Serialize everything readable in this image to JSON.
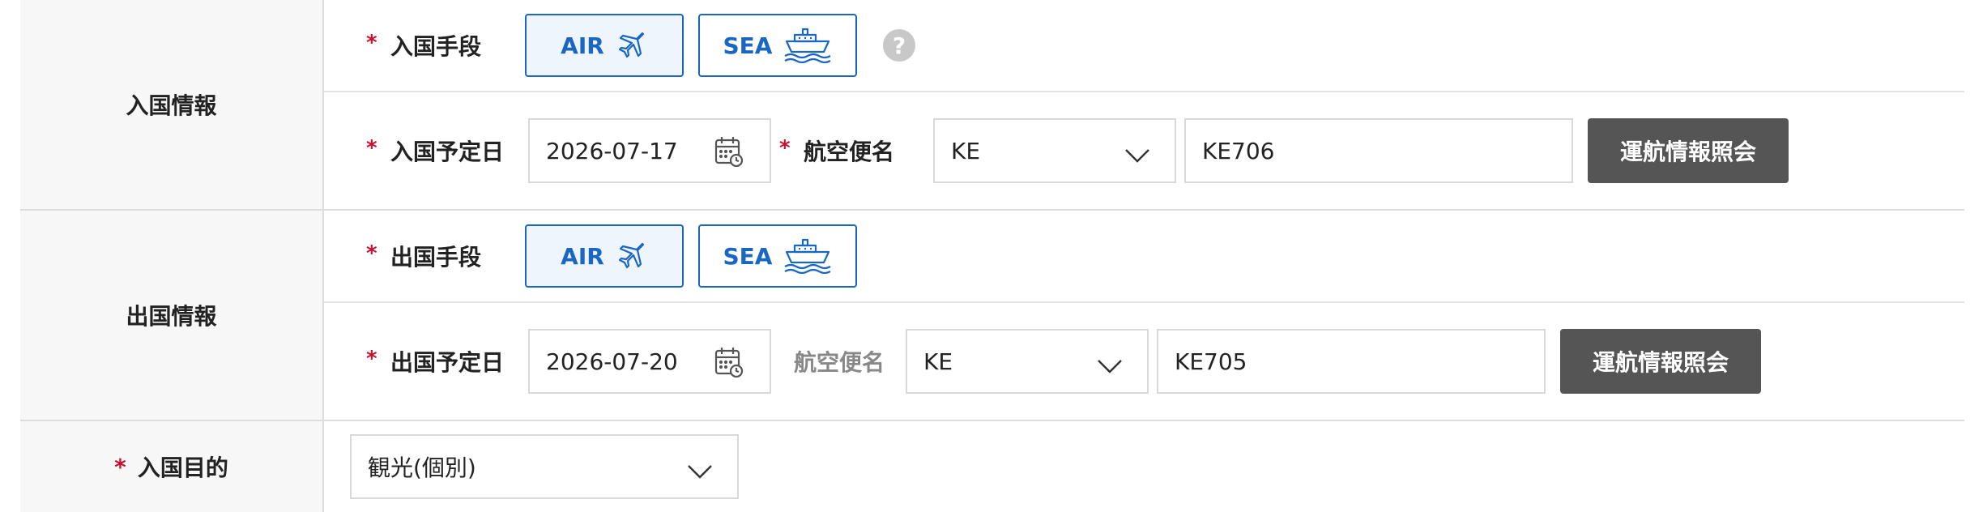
{
  "entry_info": {
    "section_label": "入国情報",
    "means_label": "入国手段",
    "means_options": [
      {
        "label": "AIR",
        "icon": "airplane-icon",
        "selected": true
      },
      {
        "label": "SEA",
        "icon": "ship-icon",
        "selected": false
      }
    ],
    "help": "?",
    "date_label": "入国予定日",
    "date_value": "2026-07-17",
    "flight_label": "航空便名",
    "airline_value": "KE",
    "flight_number": "KE706",
    "query_button": "運航情報照会"
  },
  "exit_info": {
    "section_label": "出国情報",
    "means_label": "出国手段",
    "means_options": [
      {
        "label": "AIR",
        "icon": "airplane-icon",
        "selected": true
      },
      {
        "label": "SEA",
        "icon": "ship-icon",
        "selected": false
      }
    ],
    "date_label": "出国予定日",
    "date_value": "2026-07-20",
    "flight_label": "航空便名",
    "airline_value": "KE",
    "flight_number": "KE705",
    "query_button": "運航情報照会"
  },
  "purpose": {
    "label": "入国目的",
    "value": "観光(個別)"
  },
  "required_mark": "*",
  "colors": {
    "required": "#c8102e",
    "accent": "#1a67c3",
    "button_dark": "#555555",
    "label_bg": "#f7f7f7"
  }
}
